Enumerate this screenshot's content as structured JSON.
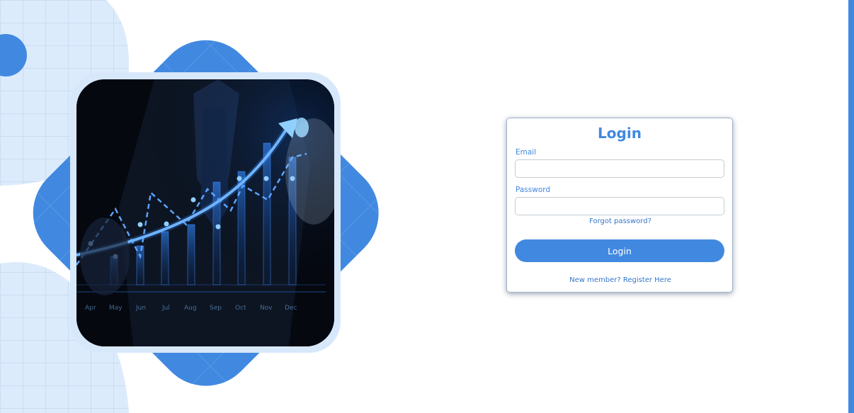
{
  "login": {
    "title": "Login",
    "email_label": "Email",
    "email_value": "",
    "password_label": "Password",
    "password_value": "",
    "forgot_link": "Forgot password?",
    "submit_label": "Login",
    "register_link": "New member? Register Here"
  },
  "illustration": {
    "months": [
      "Apr",
      "May",
      "Jun",
      "Jul",
      "Aug",
      "Sep",
      "Oct",
      "Nov",
      "Dec"
    ]
  },
  "colors": {
    "accent": "#4189e0",
    "light_accent": "#d8e8fb",
    "photo_background": "#04070f"
  }
}
